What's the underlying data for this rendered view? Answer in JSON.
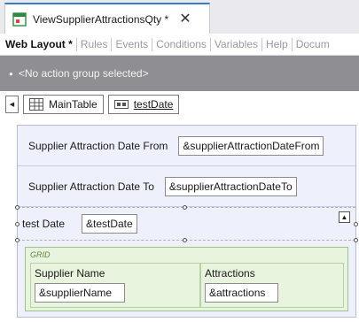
{
  "document_tab": {
    "title": "ViewSupplierAttractionsQty *",
    "close": "✕",
    "icon": "object-icon"
  },
  "subtabs": [
    "Web Layout *",
    "Rules",
    "Events",
    "Conditions",
    "Variables",
    "Help",
    "Docum"
  ],
  "action_group": {
    "text": "<No action group selected>"
  },
  "breadcrumb": {
    "back": "◀",
    "main_table": "MainTable",
    "test_date": "testDate"
  },
  "form": {
    "row1": {
      "label": "Supplier Attraction Date From",
      "value": "&supplierAttractionDateFrom"
    },
    "row2": {
      "label": "Supplier Attraction Date To",
      "value": "&supplierAttractionDateTo"
    },
    "row3": {
      "label": "test Date",
      "value": "&testDate",
      "up_button": "▲"
    }
  },
  "grid": {
    "tag": "GRID",
    "columns": [
      {
        "header": "Supplier Name",
        "value": "&supplierName"
      },
      {
        "header": "Attractions",
        "value": "&attractions"
      }
    ]
  },
  "colors": {
    "accent": "#3a7dcf",
    "action_bar": "#8f8f93",
    "canvas": "#eef0fb",
    "grid_bg": "#e8f4de"
  }
}
